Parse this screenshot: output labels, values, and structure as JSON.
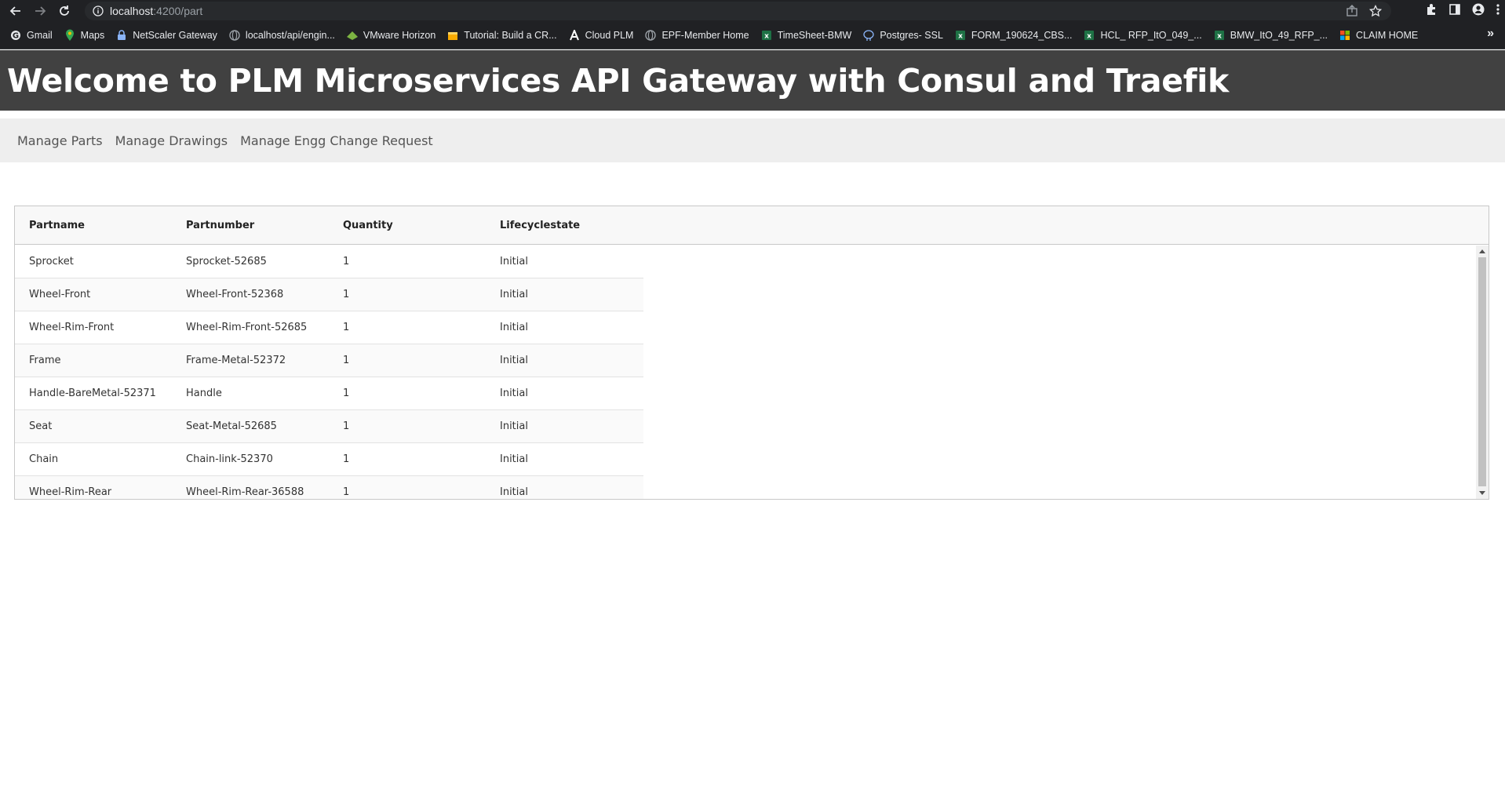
{
  "browser": {
    "url_host": "localhost",
    "url_path": ":4200/part",
    "bookmarks": [
      {
        "label": "Gmail",
        "icon": "google-icon"
      },
      {
        "label": "Maps",
        "icon": "maps-pin-icon"
      },
      {
        "label": "NetScaler Gateway",
        "icon": "lock-icon"
      },
      {
        "label": "localhost/api/engin...",
        "icon": "globe-icon"
      },
      {
        "label": "VMware Horizon",
        "icon": "vmware-icon"
      },
      {
        "label": "Tutorial: Build a CR...",
        "icon": "box-icon"
      },
      {
        "label": "Cloud PLM",
        "icon": "letter-a-icon"
      },
      {
        "label": "EPF-Member Home",
        "icon": "globe-icon"
      },
      {
        "label": "TimeSheet-BMW",
        "icon": "excel-icon"
      },
      {
        "label": "Postgres- SSL",
        "icon": "elephant-icon"
      },
      {
        "label": "FORM_190624_CBS...",
        "icon": "excel-icon"
      },
      {
        "label": "HCL_ RFP_ItO_049_...",
        "icon": "excel-icon"
      },
      {
        "label": "BMW_ItO_49_RFP_...",
        "icon": "excel-icon"
      },
      {
        "label": "CLAIM HOME",
        "icon": "microsoft-icon"
      }
    ],
    "more_label": "»"
  },
  "header": {
    "title": "Welcome to PLM Microservices API Gateway with Consul and Traefik"
  },
  "nav": {
    "items": [
      "Manage Parts",
      "Manage Drawings",
      "Manage Engg Change Request"
    ]
  },
  "table": {
    "columns": [
      "Partname",
      "Partnumber",
      "Quantity",
      "Lifecyclestate"
    ],
    "rows": [
      [
        "Sprocket",
        "Sprocket-52685",
        "1",
        "Initial"
      ],
      [
        "Wheel-Front",
        "Wheel-Front-52368",
        "1",
        "Initial"
      ],
      [
        "Wheel-Rim-Front",
        "Wheel-Rim-Front-52685",
        "1",
        "Initial"
      ],
      [
        "Frame",
        "Frame-Metal-52372",
        "1",
        "Initial"
      ],
      [
        "Handle-BareMetal-52371",
        "Handle",
        "1",
        "Initial"
      ],
      [
        "Seat",
        "Seat-Metal-52685",
        "1",
        "Initial"
      ],
      [
        "Chain",
        "Chain-link-52370",
        "1",
        "Initial"
      ],
      [
        "Wheel-Rim-Rear",
        "Wheel-Rim-Rear-36588",
        "1",
        "Initial"
      ]
    ]
  },
  "colors": {
    "header_bg": "#414141",
    "nav_bg": "#eeeeee",
    "chrome_bg": "#202124"
  }
}
